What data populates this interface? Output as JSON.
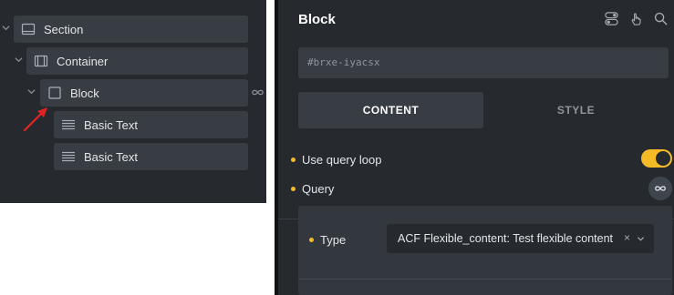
{
  "structure": {
    "items": [
      {
        "label": "Section",
        "icon": "section-icon",
        "expanded": true
      },
      {
        "label": "Container",
        "icon": "container-icon",
        "expanded": true
      },
      {
        "label": "Block",
        "icon": "block-icon",
        "expanded": true,
        "has_query_loop": true
      },
      {
        "label": "Basic Text",
        "icon": "text-lines-icon"
      },
      {
        "label": "Basic Text",
        "icon": "text-lines-icon"
      }
    ],
    "annotation": "red-arrow-icon"
  },
  "block_panel": {
    "title": "Block",
    "header_icons": [
      "toggle-switch-icon",
      "touch-hand-icon",
      "search-icon"
    ],
    "element_id": "#brxe-iyacsx",
    "tabs": [
      {
        "label": "CONTENT",
        "active": true
      },
      {
        "label": "STYLE",
        "active": false
      }
    ],
    "controls": {
      "use_query_loop": {
        "label": "Use query loop",
        "enabled": true
      },
      "query": {
        "label": "Query",
        "icon": "infinity-icon"
      }
    },
    "query_settings": {
      "type_label": "Type",
      "type_value": "ACF Flexible_content: Test flexible content",
      "clear_glyph": "×"
    }
  },
  "colors": {
    "panel_bg": "#262a2f",
    "item_bg": "#383d43",
    "accent": "#f5bb27",
    "annotation_red": "#e02424"
  }
}
